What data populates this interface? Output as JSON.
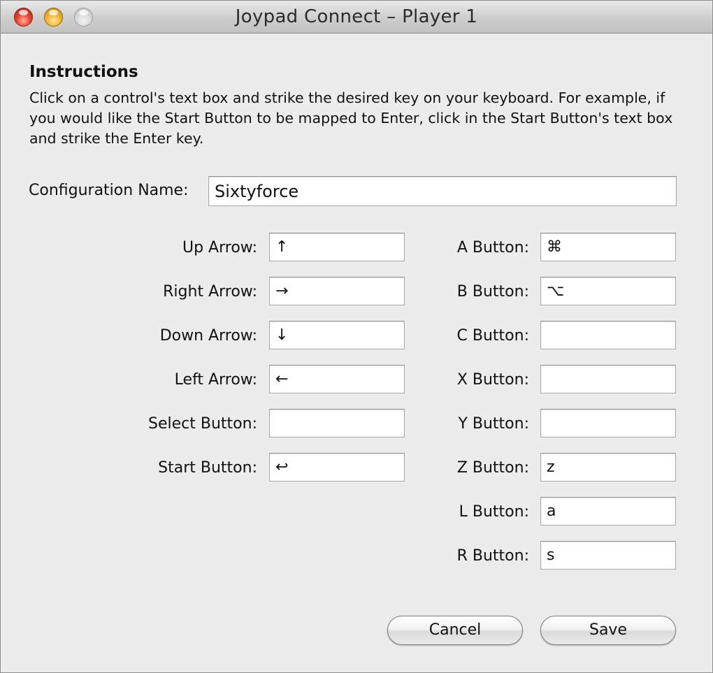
{
  "window": {
    "title": "Joypad Connect – Player 1"
  },
  "instructions": {
    "heading": "Instructions",
    "text": "Click on a control's text box and strike the desired key on your keyboard. For example, if you would like the Start Button to be mapped to Enter, click in the Start Button's text box and strike the Enter key."
  },
  "config": {
    "label": "Configuration Name:",
    "value": "Sixtyforce"
  },
  "left_controls": [
    {
      "label": "Up Arrow:",
      "value": "↑"
    },
    {
      "label": "Right Arrow:",
      "value": "→"
    },
    {
      "label": "Down Arrow:",
      "value": "↓"
    },
    {
      "label": "Left Arrow:",
      "value": "←"
    },
    {
      "label": "Select Button:",
      "value": ""
    },
    {
      "label": "Start Button:",
      "value": "↩"
    }
  ],
  "right_controls": [
    {
      "label": "A Button:",
      "value": "⌘"
    },
    {
      "label": "B Button:",
      "value": "⌥"
    },
    {
      "label": "C Button:",
      "value": ""
    },
    {
      "label": "X Button:",
      "value": ""
    },
    {
      "label": "Y Button:",
      "value": ""
    },
    {
      "label": "Z Button:",
      "value": "z"
    },
    {
      "label": "L Button:",
      "value": "a"
    },
    {
      "label": "R Button:",
      "value": "s"
    }
  ],
  "buttons": {
    "cancel": "Cancel",
    "save": "Save"
  },
  "icons": {
    "close": "close-button-icon",
    "minimize": "minimize-button-icon",
    "zoom": "zoom-button-icon"
  }
}
